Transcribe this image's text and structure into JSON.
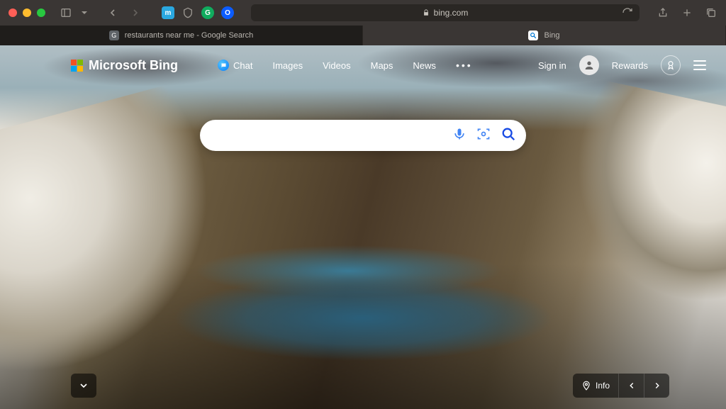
{
  "browser": {
    "url_host": "bing.com",
    "tabs": [
      {
        "title": "restaurants near me - Google Search",
        "active": false
      },
      {
        "title": "Bing",
        "active": true
      }
    ]
  },
  "bing": {
    "logo_text": "Microsoft Bing",
    "nav": {
      "chat": "Chat",
      "images": "Images",
      "videos": "Videos",
      "maps": "Maps",
      "news": "News"
    },
    "signin": "Sign in",
    "rewards": "Rewards",
    "search_placeholder": "",
    "info_label": "Info"
  }
}
